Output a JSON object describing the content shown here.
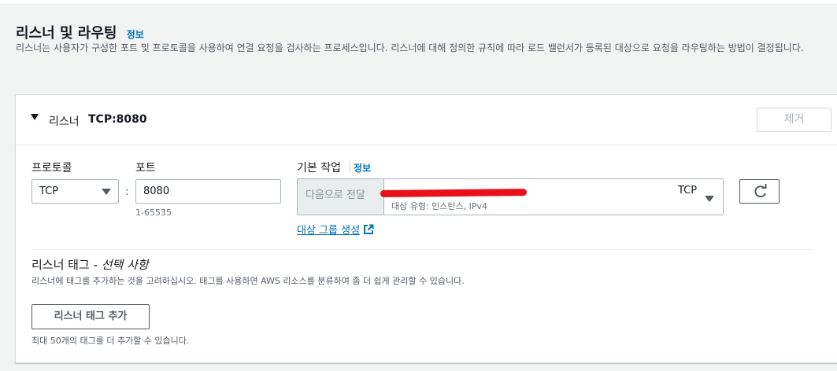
{
  "section": {
    "title": "리스너 및 라우팅",
    "info": "정보",
    "description": "리스너는 사용자가 구성한 포트 및 프로토콜을 사용하여 연결 요청을 검사하는 프로세스입니다. 리스너에 대해 정의한 규칙에 따라 로드 밸런서가 등록된 대상으로 요청을 라우팅하는 방법이 결정됩니다."
  },
  "listener": {
    "prefix": "리스너",
    "name": "TCP:8080",
    "remove_label": "제거",
    "protocol_label": "프로토콜",
    "protocol_value": "TCP",
    "colon": ":",
    "port_label": "포트",
    "port_value": "8080",
    "port_hint": "1-65535",
    "default_action_label": "기본 작업",
    "default_action_info": "정보",
    "action_prefix": "다음으로 전달",
    "target_group_meta": "대상 유형: 인스턴스, IPv4",
    "target_group_protocol": "TCP",
    "create_target_group": "대상 그룹 생성"
  },
  "tags": {
    "title": "리스너 태그 - ",
    "optional": "선택 사항",
    "description": "리스너에 태그를 추가하는 것을 고려하십시오. 태그를 사용하면 AWS 리소스를 분류하여 좀 더 쉽게 관리할 수 있습니다.",
    "add_label": "리스너 태그 추가",
    "limit": "최대 50개의 태그를 더 추가할 수 있습니다."
  },
  "icons": {
    "caret": "caret-down-icon",
    "refresh": "refresh-icon",
    "external": "external-link-icon"
  },
  "colors": {
    "link": "#0073bb",
    "redaction": "#e8101a"
  }
}
